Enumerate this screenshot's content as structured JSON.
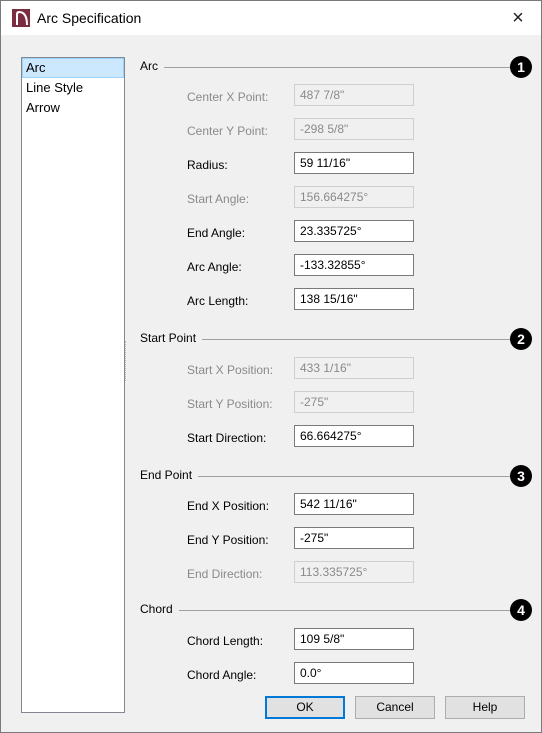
{
  "window": {
    "title": "Arc Specification",
    "close_glyph": "×"
  },
  "nav": {
    "items": [
      {
        "label": "Arc",
        "selected": true
      },
      {
        "label": "Line Style",
        "selected": false
      },
      {
        "label": "Arrow",
        "selected": false
      }
    ]
  },
  "arc": {
    "label": "Arc",
    "badge": "1",
    "fields": [
      {
        "label": "Center X Point:",
        "value": "487 7/8\"",
        "enabled": false
      },
      {
        "label": "Center Y Point:",
        "value": "-298 5/8\"",
        "enabled": false
      },
      {
        "label": "Radius:",
        "value": "59 11/16\"",
        "enabled": true
      },
      {
        "label": "Start Angle:",
        "value": "156.664275°",
        "enabled": false
      },
      {
        "label": "End Angle:",
        "value": "23.335725°",
        "enabled": true
      },
      {
        "label": "Arc Angle:",
        "value": "-133.32855°",
        "enabled": true
      },
      {
        "label": "Arc Length:",
        "value": "138 15/16\"",
        "enabled": true
      }
    ]
  },
  "start_point": {
    "label": "Start Point",
    "badge": "2",
    "fields": [
      {
        "label": "Start X Position:",
        "value": "433 1/16\"",
        "enabled": false
      },
      {
        "label": "Start Y Position:",
        "value": "-275\"",
        "enabled": false
      },
      {
        "label": "Start Direction:",
        "value": "66.664275°",
        "enabled": true
      }
    ]
  },
  "end_point": {
    "label": "End Point",
    "badge": "3",
    "fields": [
      {
        "label": "End X Position:",
        "value": "542 11/16\"",
        "enabled": true
      },
      {
        "label": "End Y Position:",
        "value": "-275\"",
        "enabled": true
      },
      {
        "label": "End Direction:",
        "value": "113.335725°",
        "enabled": false
      }
    ]
  },
  "chord": {
    "label": "Chord",
    "badge": "4",
    "fields": [
      {
        "label": "Chord Length:",
        "value": "109 5/8\"",
        "enabled": true
      },
      {
        "label": "Chord Angle:",
        "value": "0.0°",
        "enabled": true
      }
    ]
  },
  "buttons": {
    "ok": "OK",
    "cancel": "Cancel",
    "help": "Help"
  },
  "colors": {
    "selection_bg": "#cce8ff",
    "default_button_border": "#0078d7",
    "app_icon": "#7b2c40"
  }
}
